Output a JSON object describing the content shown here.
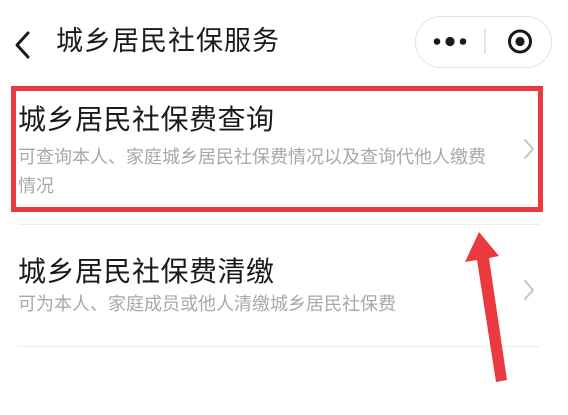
{
  "header": {
    "title": "城乡居民社保服务",
    "back_icon": "chevron-left-icon",
    "more_icon": "more-dots-icon",
    "close_icon": "target-close-icon"
  },
  "items": [
    {
      "title": "城乡居民社保费查询",
      "description": "可查询本人、家庭城乡居民社保费情况以及查询代他人缴费情况",
      "arrow_icon": "chevron-right-icon"
    },
    {
      "title": "城乡居民社保费清缴",
      "description": "可为本人、家庭成员或他人清缴城乡居民社保费",
      "arrow_icon": "chevron-right-icon"
    }
  ],
  "colors": {
    "highlight": "#ea3a3f",
    "title_text": "#1a1a1a",
    "desc_text": "#a8a8a8",
    "divider": "#ececec"
  }
}
